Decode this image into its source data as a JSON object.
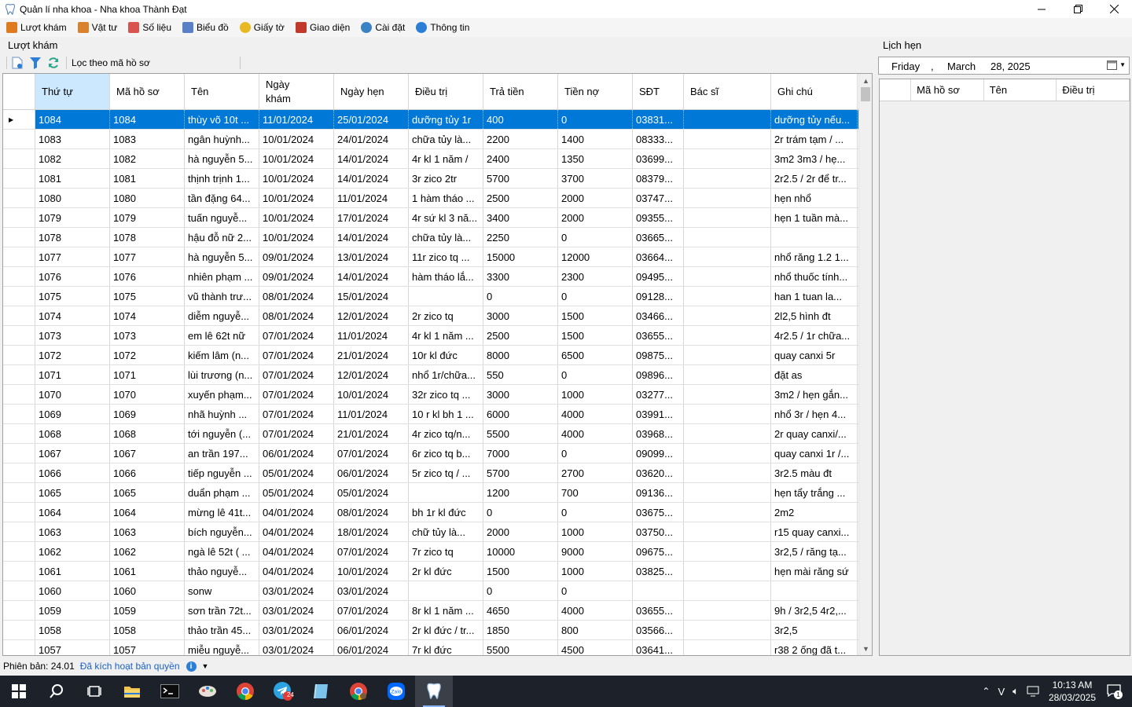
{
  "window": {
    "title": "Quản lí nha khoa - Nha khoa Thành Đạt"
  },
  "menu": [
    {
      "label": "Lượt khám",
      "icon": "clipboard-icon",
      "color": "#e07a1f"
    },
    {
      "label": "Vật tư",
      "icon": "box-icon",
      "color": "#d9822b"
    },
    {
      "label": "Số liệu",
      "icon": "blocks-icon",
      "color": "#d9534f"
    },
    {
      "label": "Biểu đồ",
      "icon": "chart-icon",
      "color": "#5b7fc7"
    },
    {
      "label": "Giấy tờ",
      "icon": "document-icon",
      "color": "#e8b923"
    },
    {
      "label": "Giao diện",
      "icon": "brush-icon",
      "color": "#c0392b"
    },
    {
      "label": "Cài đặt",
      "icon": "gear-icon",
      "color": "#3b82c4"
    },
    {
      "label": "Thông tin",
      "icon": "info-icon",
      "color": "#2b7fd6"
    }
  ],
  "left": {
    "title": "Lượt khám",
    "filter_label": "Lọc theo mã hồ sơ",
    "columns": [
      "Thứ tự",
      "Mã hồ sơ",
      "Tên",
      "Ngày\nkhám",
      "Ngày hẹn",
      "Điều trị",
      "Trả tiền",
      "Tiền nợ",
      "SĐT",
      "Bác sĩ",
      "Ghi chú"
    ],
    "rows": [
      [
        "1084",
        "1084",
        "thùy võ 10t ...",
        "11/01/2024",
        "25/01/2024",
        "dưỡng tủy 1r",
        "400",
        "0",
        "03831...",
        "",
        "dưỡng tủy nếu..."
      ],
      [
        "1083",
        "1083",
        "ngân huỳnh...",
        "10/01/2024",
        "24/01/2024",
        "chữa tủy là...",
        "2200",
        "1400",
        "08333...",
        "",
        "2r trám tạm / ..."
      ],
      [
        "1082",
        "1082",
        "hà nguyễn 5...",
        "10/01/2024",
        "14/01/2024",
        "4r kl 1 năm /",
        "2400",
        "1350",
        "03699...",
        "",
        "3m2 3m3 / hẹ..."
      ],
      [
        "1081",
        "1081",
        "thịnh trịnh 1...",
        "10/01/2024",
        "14/01/2024",
        "3r zico 2tr",
        "5700",
        "3700",
        "08379...",
        "",
        "2r2.5 / 2r để tr..."
      ],
      [
        "1080",
        "1080",
        "tần đặng 64...",
        "10/01/2024",
        "11/01/2024",
        "1 hàm tháo ...",
        "2500",
        "2000",
        "03747...",
        "",
        "hẹn nhổ"
      ],
      [
        "1079",
        "1079",
        "tuấn nguyễ...",
        "10/01/2024",
        "17/01/2024",
        "4r sứ kl 3 nă...",
        "3400",
        "2000",
        "09355...",
        "",
        "hẹn 1 tuần mà..."
      ],
      [
        "1078",
        "1078",
        "hậu đỗ nữ 2...",
        "10/01/2024",
        "14/01/2024",
        "chữa tủy là...",
        "2250",
        "0",
        "03665...",
        "",
        ""
      ],
      [
        "1077",
        "1077",
        "hà nguyễn 5...",
        "09/01/2024",
        "13/01/2024",
        "11r zico tq ...",
        "15000",
        "12000",
        "03664...",
        "",
        "nhổ răng 1.2 1..."
      ],
      [
        "1076",
        "1076",
        "nhiên phạm ...",
        "09/01/2024",
        "14/01/2024",
        "hàm tháo lắ...",
        "3300",
        "2300",
        "09495...",
        "",
        "nhổ thuốc tính..."
      ],
      [
        "1075",
        "1075",
        "vũ thành trư...",
        "08/01/2024",
        "15/01/2024",
        "",
        "0",
        "0",
        "09128...",
        "",
        "han 1 tuan la..."
      ],
      [
        "1074",
        "1074",
        "diễm nguyễ...",
        "08/01/2024",
        "12/01/2024",
        "2r zico tq",
        "3000",
        "1500",
        "03466...",
        "",
        "2l2,5 hình đt"
      ],
      [
        "1073",
        "1073",
        "em lê 62t nữ",
        "07/01/2024",
        "11/01/2024",
        "4r kl 1 năm ...",
        "2500",
        "1500",
        "03655...",
        "",
        "4r2.5 / 1r chữa..."
      ],
      [
        "1072",
        "1072",
        "kiếm lâm (n...",
        "07/01/2024",
        "21/01/2024",
        "10r kl đức",
        "8000",
        "6500",
        "09875...",
        "",
        "quay canxi 5r"
      ],
      [
        "1071",
        "1071",
        "lùi trương (n...",
        "07/01/2024",
        "12/01/2024",
        "nhổ 1r/chữa...",
        "550",
        "0",
        "09896...",
        "",
        "đặt as"
      ],
      [
        "1070",
        "1070",
        "xuyến phạm...",
        "07/01/2024",
        "10/01/2024",
        "32r zico tq ...",
        "3000",
        "1000",
        "03277...",
        "",
        "3m2 / hẹn gắn..."
      ],
      [
        "1069",
        "1069",
        "nhã huỳnh ...",
        "07/01/2024",
        "11/01/2024",
        "10 r kl bh 1 ...",
        "6000",
        "4000",
        "03991...",
        "",
        "nhổ 3r / hẹn 4..."
      ],
      [
        "1068",
        "1068",
        "tới nguyễn (...",
        "07/01/2024",
        "21/01/2024",
        "4r zico tq/n...",
        "5500",
        "4000",
        "03968...",
        "",
        "2r quay canxi/..."
      ],
      [
        "1067",
        "1067",
        "an trần 197...",
        "06/01/2024",
        "07/01/2024",
        "6r zico tq b...",
        "7000",
        "0",
        "09099...",
        "",
        "quay canxi 1r /..."
      ],
      [
        "1066",
        "1066",
        "tiếp nguyễn ...",
        "05/01/2024",
        "06/01/2024",
        "5r zico tq / ...",
        "5700",
        "2700",
        "03620...",
        "",
        "3r2.5 màu đt"
      ],
      [
        "1065",
        "1065",
        "duẩn phạm ...",
        "05/01/2024",
        "05/01/2024",
        "",
        "1200",
        "700",
        "09136...",
        "",
        "hẹn tẩy trắng ..."
      ],
      [
        "1064",
        "1064",
        "mừng lê 41t...",
        "04/01/2024",
        "08/01/2024",
        "bh 1r kl đức",
        "0",
        "0",
        "03675...",
        "",
        "2m2"
      ],
      [
        "1063",
        "1063",
        "bích nguyễn...",
        "04/01/2024",
        "18/01/2024",
        "chữ tủy là...",
        "2000",
        "1000",
        "03750...",
        "",
        "r15 quay canxi..."
      ],
      [
        "1062",
        "1062",
        "ngà lê 52t ( ...",
        "04/01/2024",
        "07/01/2024",
        "7r zico tq",
        "10000",
        "9000",
        "09675...",
        "",
        "3r2,5 / răng tạ..."
      ],
      [
        "1061",
        "1061",
        "thảo nguyễ...",
        "04/01/2024",
        "10/01/2024",
        "2r kl đức",
        "1500",
        "1000",
        "03825...",
        "",
        "hẹn mài răng sứ"
      ],
      [
        "1060",
        "1060",
        "sonw",
        "03/01/2024",
        "03/01/2024",
        "",
        "0",
        "0",
        "",
        "",
        ""
      ],
      [
        "1059",
        "1059",
        "sơn trần 72t...",
        "03/01/2024",
        "07/01/2024",
        "8r kl 1 năm ...",
        "4650",
        "4000",
        "03655...",
        "",
        "9h / 3r2,5 4r2,..."
      ],
      [
        "1058",
        "1058",
        "thảo trần 45...",
        "03/01/2024",
        "06/01/2024",
        "2r kl đức / tr...",
        "1850",
        "800",
        "03566...",
        "",
        "3r2,5"
      ],
      [
        "1057",
        "1057",
        "miễu nguyễ...",
        "03/01/2024",
        "06/01/2024",
        "7r kl đức",
        "5500",
        "4500",
        "03641...",
        "",
        "r38 2 ống đã t..."
      ]
    ]
  },
  "right": {
    "title": "Lịch hẹn",
    "date": {
      "weekday": "Friday",
      "sep": ",",
      "month": "March",
      "day_year": "28, 2025"
    },
    "columns": [
      "Mã hồ sơ",
      "Tên",
      "Điều trị"
    ]
  },
  "status": {
    "version": "Phiên bản: 24.01",
    "license": "Đã kích hoạt bản quyền"
  },
  "taskbar": {
    "time": "10:13 AM",
    "date": "28/03/2025",
    "telegram_badge": "24",
    "notif_badge": "1"
  }
}
